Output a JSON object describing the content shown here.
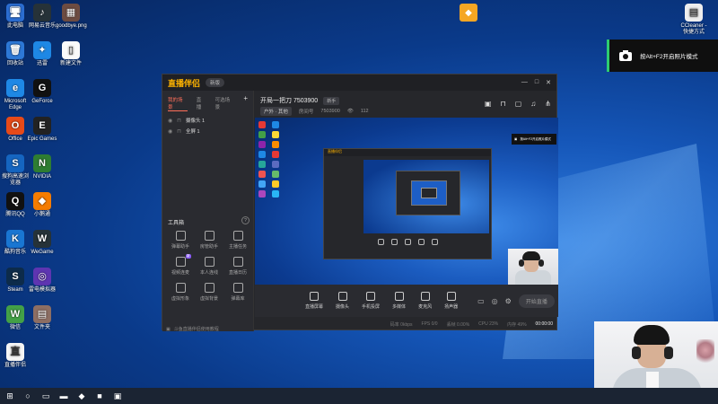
{
  "desktop": {
    "icons_col1": [
      {
        "label": "此电脑",
        "glyph": "🖥",
        "bg": "#2b6dd1"
      },
      {
        "label": "回收站",
        "glyph": "🗑",
        "bg": "#2d78d6"
      },
      {
        "label": "Microsoft Edge",
        "glyph": "e",
        "bg": "#1e88e5"
      },
      {
        "label": "Office",
        "glyph": "O",
        "bg": "#e64a19"
      },
      {
        "label": "搜狗高速浏览器",
        "glyph": "S",
        "bg": "#1565c0"
      },
      {
        "label": "腾讯QQ",
        "glyph": "Q",
        "bg": "#111"
      },
      {
        "label": "酷狗音乐",
        "glyph": "K",
        "bg": "#1976d2"
      },
      {
        "label": "Steam",
        "glyph": "S",
        "bg": "#0d2b4a"
      },
      {
        "label": "微信",
        "glyph": "W",
        "bg": "#43a047"
      },
      {
        "label": "直播伴侣",
        "glyph": "直",
        "bg": "#f5f5f5"
      }
    ],
    "icons_col2": [
      {
        "label": "网易云音乐",
        "glyph": "♪",
        "bg": "#263238"
      },
      {
        "label": "迅雷",
        "glyph": "✦",
        "bg": "#1e88e5"
      },
      {
        "label": "GeForce",
        "glyph": "G",
        "bg": "#111"
      },
      {
        "label": "Epic Games",
        "glyph": "E",
        "bg": "#222"
      },
      {
        "label": "NVIDIA",
        "glyph": "N",
        "bg": "#2e7d32"
      },
      {
        "label": "小鹅通",
        "glyph": "◆",
        "bg": "#f57c00"
      },
      {
        "label": "WeGame",
        "glyph": "W",
        "bg": "#263238"
      },
      {
        "label": "雷电模拟器",
        "glyph": "◎",
        "bg": "#5e35b1"
      },
      {
        "label": "文件夹",
        "glyph": "▤",
        "bg": "#8d6e63"
      }
    ],
    "icons_col3": [
      {
        "label": "goodbye.png",
        "glyph": "▦",
        "bg": "#6d4c41"
      },
      {
        "label": "新建文件",
        "glyph": "▯",
        "bg": "#fafafa"
      }
    ],
    "corner_right_label": "CCleaner - 快捷方式",
    "corner_top_app": "小鹅通"
  },
  "notification": {
    "icon": "camera-icon",
    "text": "按Alt+F2开启照片模式"
  },
  "app": {
    "name": "直播伴侣",
    "version": "新版",
    "window_controls": [
      "—",
      "□",
      "✕"
    ],
    "left_tabs": [
      "我的场景",
      "直播",
      "可选场景"
    ],
    "add_label": "+",
    "scenes": [
      {
        "label": "摄像头 1"
      },
      {
        "label": "全屏 1"
      }
    ],
    "tools_title": "工具箱",
    "tools": [
      {
        "label": "弹幕助手",
        "badge": ""
      },
      {
        "label": "房管助手",
        "badge": ""
      },
      {
        "label": "主播任务",
        "badge": ""
      },
      {
        "label": "视频连麦",
        "badge": "新"
      },
      {
        "label": "本人连线",
        "badge": ""
      },
      {
        "label": "直播日历",
        "badge": ""
      },
      {
        "label": "虚拟形象",
        "badge": ""
      },
      {
        "label": "虚拟背景",
        "badge": ""
      },
      {
        "label": "弹幕库",
        "badge": ""
      }
    ],
    "footer_text": "斗鱼直播伴侣使用教程",
    "room": {
      "title": "开局一把刀 7503900",
      "tag": "新手",
      "category": "户外 · 其他",
      "id_label": "房间号",
      "id": "7503900",
      "viewers": "112"
    },
    "bottom_buttons": [
      "直播屏幕",
      "摄像头",
      "手机投屏",
      "多媒体",
      "麦克风",
      "扬声器"
    ],
    "start_label": "开始直播",
    "status": {
      "bitrate": "码率 0kbps",
      "fps": "FPS 0/0",
      "drop": "丢帧 0.00%",
      "cpu": "CPU 23%",
      "mem": "内存 49%",
      "record": "00:00:00"
    }
  },
  "taskbar": {
    "items": [
      "⊞",
      "○",
      "▭",
      "▬",
      "◆",
      "■",
      "▣"
    ]
  }
}
